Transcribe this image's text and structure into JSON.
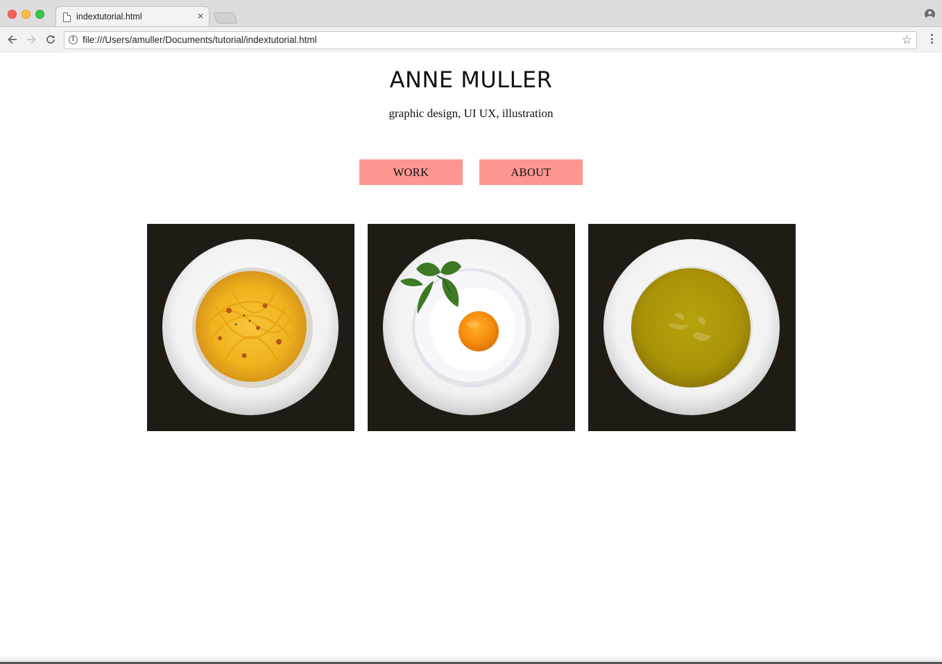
{
  "browser": {
    "tab_title": "indextutorial.html",
    "tab_close": "×",
    "url": "file:///Users/amuller/Documents/tutorial/indextutorial.html",
    "icons": [
      "close-window-icon",
      "minimize-window-icon",
      "zoom-window-icon",
      "document-icon",
      "new-tab-icon",
      "profile-icon",
      "back-arrow-icon",
      "forward-arrow-icon",
      "reload-icon",
      "info-icon",
      "star-icon",
      "menu-icon"
    ]
  },
  "page": {
    "title": "ANNE MULLER",
    "tagline": "graphic design, UI UX, illustration",
    "nav": {
      "work": "WORK",
      "about": "ABOUT"
    },
    "gallery": [
      {
        "subject": "spaghetti plate"
      },
      {
        "subject": "fried egg plate"
      },
      {
        "subject": "soup bowl"
      }
    ]
  },
  "colors": {
    "button_bg": "#fd9690",
    "tile_bg": "#201b15",
    "traffic_red": "#fc605c",
    "traffic_yellow": "#fdbc40",
    "traffic_green": "#34c84a"
  }
}
